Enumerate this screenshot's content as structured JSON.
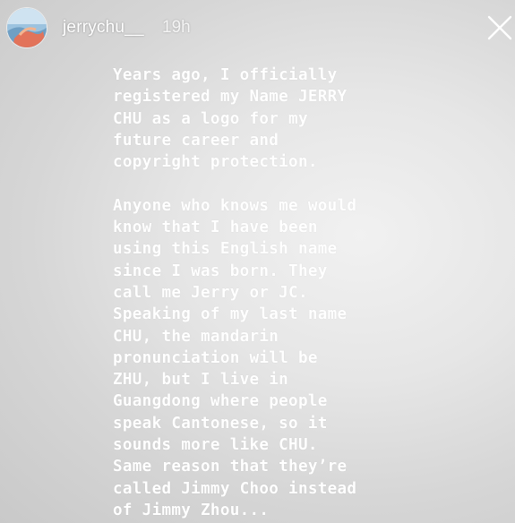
{
  "header": {
    "username": "jerrychu__",
    "timestamp": "19h",
    "avatar_icon": "profile-avatar",
    "close_icon": "close-x-icon"
  },
  "story": {
    "text": "Years ago, I officially\nregistered my Name JERRY\nCHU as a logo for my\nfuture career and\ncopyright protection.\n\nAnyone who knows me would\nknow that I have been\nusing this English name\nsince I was born. They\ncall me Jerry or JC.\nSpeaking of my last name\nCHU, the mandarin\npronunciation will be\nZHU, but I live in\nGuangdong where people\nspeak Cantonese, so it\nsounds more like CHU.\nSame reason that they’re\ncalled Jimmy Choo instead\nof Jimmy Zhou..."
  },
  "colors": {
    "background": "#dcdcdc",
    "text": "#ffffff",
    "avatar_sky": "#7fb6dc",
    "avatar_accent": "#e2735a"
  }
}
